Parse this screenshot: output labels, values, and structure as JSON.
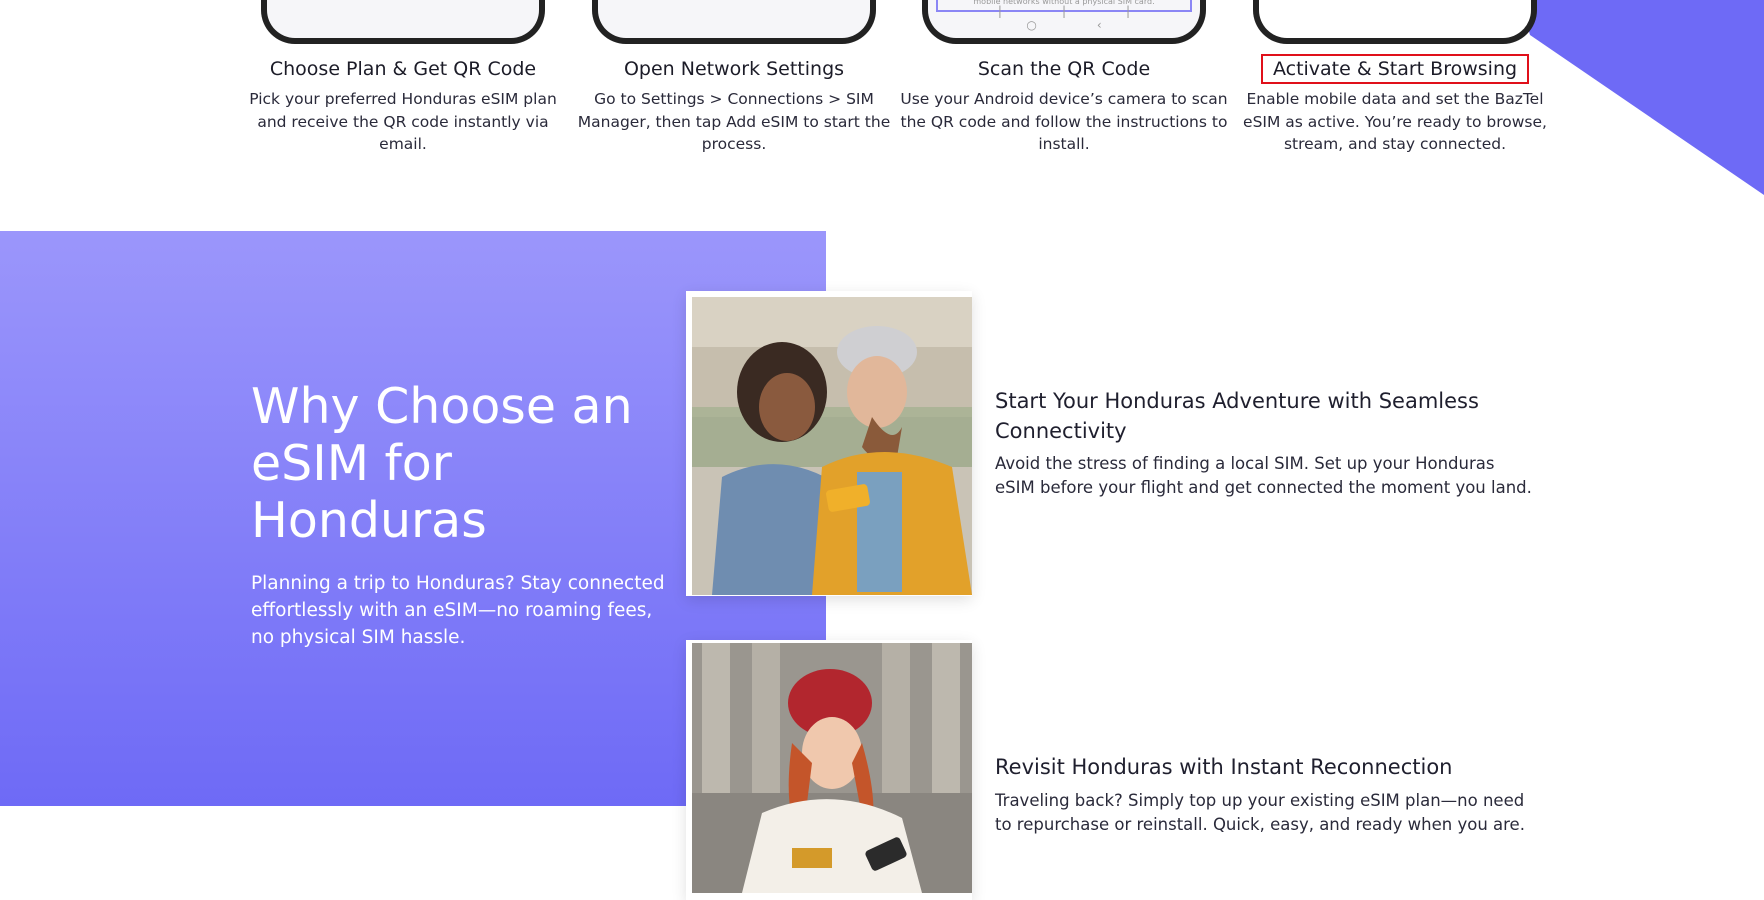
{
  "steps": [
    {
      "title": "Choose Plan & Get QR Code",
      "desc": "Pick your preferred Honduras eSIM plan and receive the QR code instantly via email.",
      "phone_text": ""
    },
    {
      "title": "Open Network Settings",
      "desc": "Go to Settings > Connections > SIM Manager, then tap Add eSIM to start the process.",
      "phone_text": ""
    },
    {
      "title": "Scan the QR Code",
      "desc": "Use your Android device’s camera to scan the QR code and follow the instructions to install.",
      "phone_text": "mobile networks without a physical SIM card."
    },
    {
      "title": "Activate & Start Browsing",
      "desc": "Enable mobile data and set the BazTel eSIM as active. You’re ready to browse, stream, and stay connected.",
      "phone_text": ""
    }
  ],
  "hero": {
    "title": "Why Choose an eSIM for Honduras",
    "subtitle": "Planning a trip to Honduras? Stay connected effortlessly with an eSIM—no roaming fees, no physical SIM hassle."
  },
  "features": [
    {
      "title": "Start Your Honduras Adventure with Seamless Connectivity",
      "desc": "Avoid the stress of finding a local SIM. Set up your Honduras eSIM before your flight and get connected the moment you land."
    },
    {
      "title": "Revisit Honduras with Instant Reconnection",
      "desc": "Traveling back? Simply top up your existing eSIM plan—no need to repurchase or reinstall. Quick, easy, and ready when you are."
    }
  ],
  "colors": {
    "accent": "#6e6af6",
    "accent_light": "#9b96fb",
    "highlight_box": "#e0101a"
  }
}
